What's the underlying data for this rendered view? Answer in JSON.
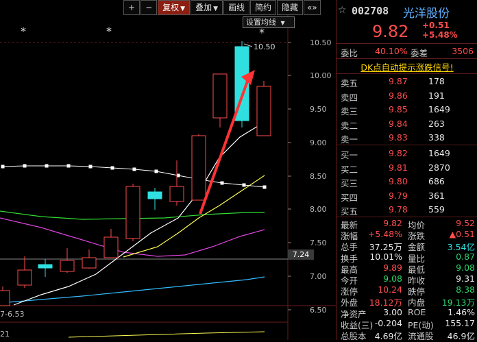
{
  "toolbar": {
    "buttons": [
      "+",
      "−",
      "复权",
      "叠加",
      "画线",
      "简约",
      "隐藏"
    ],
    "more": "«»"
  },
  "chart": {
    "indicator_setting": "设置均线",
    "stars": [
      "*",
      "*",
      "*"
    ],
    "high_label": "10.50",
    "left_label": "6.53",
    "left_label2": "21",
    "y_ticks": [
      "10.50",
      "10.00",
      "9.50",
      "9.00",
      "8.50",
      "8.00",
      "7.50",
      "7.00",
      "6.50"
    ],
    "current_tag": "7.24"
  },
  "colors": {
    "up": "#ff4d4d",
    "down": "#30e0e0",
    "ma5": "#ffffff",
    "ma10": "#ffff55",
    "ma20": "#ff44ff",
    "ma60": "#33dd33",
    "ma120": "#33bbff",
    "arrow": "#ff3333"
  },
  "quote": {
    "code": "002708",
    "name": "光洋股份",
    "price": "9.82",
    "change": "+0.51",
    "change_pct": "+5.48%",
    "weibi_label": "委比",
    "weibi": "40.10%",
    "weicha_label": "委差",
    "weicha": "3506",
    "signal": "DK点自动提示涨跌信号!",
    "asks": [
      {
        "label": "卖五",
        "price": "9.87",
        "vol": "178"
      },
      {
        "label": "卖四",
        "price": "9.86",
        "vol": "191"
      },
      {
        "label": "卖三",
        "price": "9.85",
        "vol": "1649"
      },
      {
        "label": "卖二",
        "price": "9.84",
        "vol": "263"
      },
      {
        "label": "卖一",
        "price": "9.83",
        "vol": "338"
      }
    ],
    "bids": [
      {
        "label": "买一",
        "price": "9.82",
        "vol": "1649"
      },
      {
        "label": "买二",
        "price": "9.81",
        "vol": "2870"
      },
      {
        "label": "买三",
        "price": "9.80",
        "vol": "686"
      },
      {
        "label": "买四",
        "price": "9.79",
        "vol": "361"
      },
      {
        "label": "买五",
        "price": "9.78",
        "vol": "559"
      }
    ],
    "stats": [
      {
        "l1": "最新",
        "v1": "9.82",
        "c1": "red",
        "l2": "均价",
        "v2": "9.52",
        "c2": "red"
      },
      {
        "l1": "涨幅",
        "v1": "+5.48%",
        "c1": "red",
        "l2": "涨跌",
        "v2": "▲0.51",
        "c2": "red"
      },
      {
        "l1": "总手",
        "v1": "37.25万",
        "c1": "white",
        "l2": "金额",
        "v2": "3.54亿",
        "c2": "cyan"
      },
      {
        "l1": "换手",
        "v1": "10.01%",
        "c1": "white",
        "l2": "量比",
        "v2": "0.87",
        "c2": "green"
      },
      {
        "l1": "最高",
        "v1": "9.89",
        "c1": "red",
        "l2": "最低",
        "v2": "9.08",
        "c2": "green"
      },
      {
        "l1": "今开",
        "v1": "9.08",
        "c1": "green",
        "l2": "昨收",
        "v2": "9.31",
        "c2": "white"
      },
      {
        "l1": "涨停",
        "v1": "10.24",
        "c1": "red",
        "l2": "跌停",
        "v2": "8.38",
        "c2": "green"
      },
      {
        "l1": "外盘",
        "v1": "18.12万",
        "c1": "red",
        "l2": "内盘",
        "v2": "19.13万",
        "c2": "green"
      },
      {
        "l1": "净资产",
        "v1": "3.00",
        "c1": "white",
        "l2": "ROE",
        "v2": "1.46%",
        "c2": "white"
      },
      {
        "l1": "收益(三)",
        "v1": "-0.204",
        "c1": "white",
        "l2": "PE(动)",
        "v2": "155.17",
        "c2": "white"
      },
      {
        "l1": "总股本",
        "v1": "4.69亿",
        "c1": "white",
        "l2": "流通股",
        "v2": "46.9亿",
        "c2": "white"
      }
    ]
  }
}
